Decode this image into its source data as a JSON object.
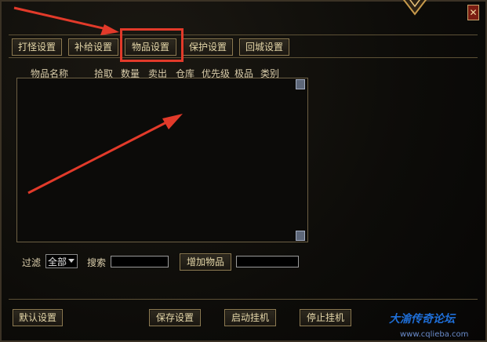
{
  "window": {
    "close_glyph": "✕"
  },
  "tabs": [
    {
      "label": "打怪设置"
    },
    {
      "label": "补给设置"
    },
    {
      "label": "物品设置"
    },
    {
      "label": "保护设置"
    },
    {
      "label": "回城设置"
    }
  ],
  "active_tab": "物品设置",
  "columns": [
    "物品名称",
    "拾取",
    "数量",
    "卖出",
    "仓库",
    "优先级",
    "极品",
    "类别"
  ],
  "items": [],
  "filter": {
    "label": "过滤",
    "selected": "全部",
    "search_label": "搜索",
    "search_value": "",
    "add_button": "增加物品",
    "add_value": ""
  },
  "footer": {
    "default_button": "默认设置",
    "save_button": "保存设置",
    "start_button": "启动挂机",
    "stop_button": "停止挂机"
  },
  "watermark": {
    "title": "大渝传奇论坛",
    "url": "www.cqlieba.com"
  },
  "colors": {
    "annotation": "#e23a2a",
    "button_text": "#e4d6a8",
    "border_gold": "#8c7a52",
    "watermark": "#1f6fd8"
  }
}
